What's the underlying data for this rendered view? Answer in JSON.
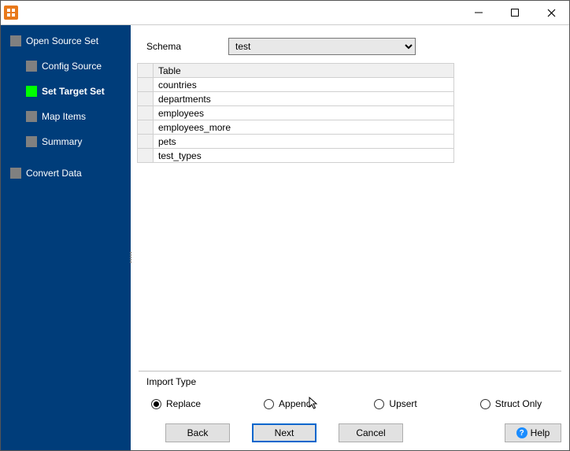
{
  "sidebar": {
    "items": [
      {
        "label": "Open Source Set",
        "active": false,
        "child": false
      },
      {
        "label": "Config Source",
        "active": false,
        "child": true
      },
      {
        "label": "Set Target Set",
        "active": true,
        "child": true
      },
      {
        "label": "Map Items",
        "active": false,
        "child": true
      },
      {
        "label": "Summary",
        "active": false,
        "child": true
      },
      {
        "label": "Convert Data",
        "active": false,
        "child": false
      }
    ]
  },
  "schema": {
    "label": "Schema",
    "value": "test"
  },
  "table": {
    "header": "Table",
    "rows": [
      "countries",
      "departments",
      "employees",
      "employees_more",
      "pets",
      "test_types"
    ]
  },
  "import": {
    "title": "Import Type",
    "options": [
      "Replace",
      "Append",
      "Upsert",
      "Struct Only"
    ],
    "selected": "Replace"
  },
  "buttons": {
    "back": "Back",
    "next": "Next",
    "cancel": "Cancel",
    "help": "Help"
  }
}
